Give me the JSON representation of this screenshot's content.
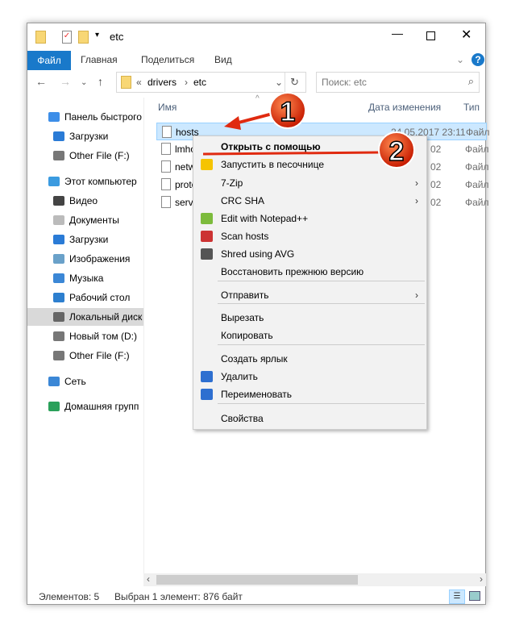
{
  "window": {
    "title": "etc"
  },
  "ribbon": {
    "tabs": [
      "Файл",
      "Главная",
      "Поделиться",
      "Вид"
    ],
    "help": "?"
  },
  "address": {
    "overflow": "«",
    "crumbs": [
      "drivers",
      "etc"
    ]
  },
  "search": {
    "placeholder": "Поиск: etc"
  },
  "sidebar": {
    "items": [
      {
        "label": "Панель быстрого",
        "color": "#3d8ee8"
      },
      {
        "label": "Загрузки",
        "color": "#2a7bd6"
      },
      {
        "label": "Other File (F:)",
        "color": "#777"
      },
      {
        "label": "Этот компьютер",
        "color": "#3b9be0"
      },
      {
        "label": "Видео",
        "color": "#444"
      },
      {
        "label": "Документы",
        "color": "#bbb"
      },
      {
        "label": "Загрузки",
        "color": "#2a7bd6"
      },
      {
        "label": "Изображения",
        "color": "#6aa1c9"
      },
      {
        "label": "Музыка",
        "color": "#3b87d6"
      },
      {
        "label": "Рабочий стол",
        "color": "#2d7fcf"
      },
      {
        "label": "Локальный диск",
        "color": "#666"
      },
      {
        "label": "Новый том (D:)",
        "color": "#777"
      },
      {
        "label": "Other File (F:)",
        "color": "#777"
      },
      {
        "label": "Сеть",
        "color": "#3b87d6"
      },
      {
        "label": "Домашняя групп",
        "color": "#2aa05a"
      }
    ]
  },
  "columns": {
    "name": "Имя",
    "date": "Дата изменения",
    "type": "Тип"
  },
  "files": [
    {
      "name": "hosts",
      "date": "24.05.2017 23:11",
      "type": "Файл"
    },
    {
      "name": "lmhosts",
      "date": "02",
      "type": "Файл"
    },
    {
      "name": "networks",
      "date": "02",
      "type": "Файл"
    },
    {
      "name": "protocol",
      "date": "02",
      "type": "Файл"
    },
    {
      "name": "services",
      "date": "02",
      "type": "Файл"
    }
  ],
  "context_menu": {
    "items": [
      "Открыть с помощью",
      "Запустить в песочнице",
      "7-Zip",
      "CRC SHA",
      "Edit with Notepad++",
      "Scan hosts",
      "Shred using AVG",
      "Восстановить прежнюю версию",
      "Отправить",
      "Вырезать",
      "Копировать",
      "Создать ярлык",
      "Удалить",
      "Переименовать",
      "Свойства"
    ]
  },
  "annotations": {
    "step1": "1",
    "step2": "2",
    "color": "#e02a10"
  },
  "status": {
    "count": "Элементов: 5",
    "selection": "Выбран 1 элемент: 876 байт"
  }
}
